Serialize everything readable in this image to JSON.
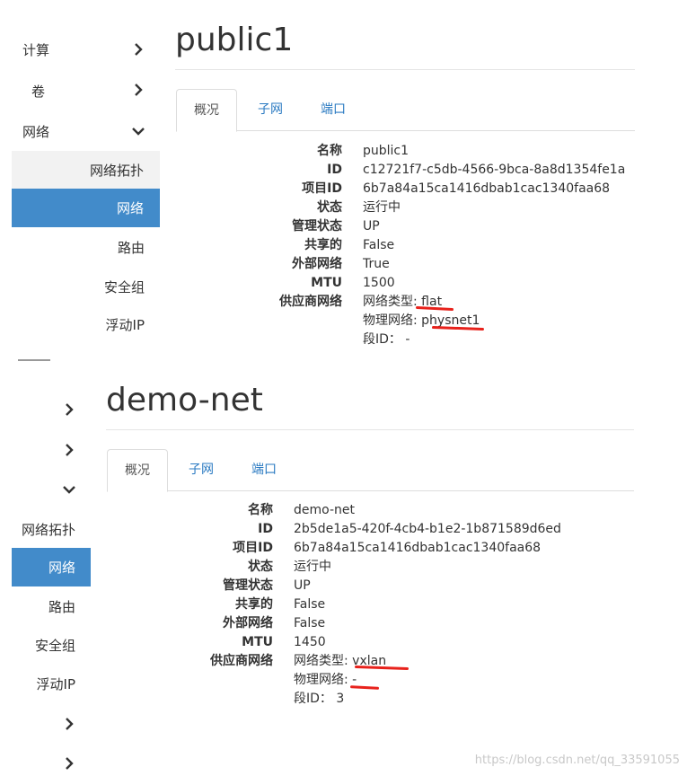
{
  "panel1": {
    "sidebar": {
      "compute": "计算",
      "volumes": "卷",
      "network": "网络",
      "topology": "网络拓扑",
      "networks": "网络",
      "routers": "路由",
      "security_groups": "安全组",
      "floating_ips": "浮动IP"
    },
    "title": "public1",
    "tabs": [
      "概况",
      "子网",
      "端口"
    ],
    "details": [
      {
        "label": "名称",
        "value": "public1"
      },
      {
        "label": "ID",
        "value": "c12721f7-c5db-4566-9bca-8a8d1354fe1a"
      },
      {
        "label": "项目ID",
        "value": "6b7a84a15ca1416dbab1cac1340faa68"
      },
      {
        "label": "状态",
        "value": "运行中"
      },
      {
        "label": "管理状态",
        "value": "UP"
      },
      {
        "label": "共享的",
        "value": "False"
      },
      {
        "label": "外部网络",
        "value": "True"
      },
      {
        "label": "MTU",
        "value": "1500"
      },
      {
        "label": "供应商网络",
        "value": "网络类型: flat"
      }
    ],
    "provider_extra": [
      "物理网络: physnet1",
      "段ID： -"
    ]
  },
  "panel2": {
    "sidebar": {
      "topology": "网络拓扑",
      "networks": "网络",
      "routers": "路由",
      "security_groups": "安全组",
      "floating_ips": "浮动IP"
    },
    "title": "demo-net",
    "tabs": [
      "概况",
      "子网",
      "端口"
    ],
    "details": [
      {
        "label": "名称",
        "value": "demo-net"
      },
      {
        "label": "ID",
        "value": "2b5de1a5-420f-4cb4-b1e2-1b871589d6ed"
      },
      {
        "label": "项目ID",
        "value": "6b7a84a15ca1416dbab1cac1340faa68"
      },
      {
        "label": "状态",
        "value": "运行中"
      },
      {
        "label": "管理状态",
        "value": "UP"
      },
      {
        "label": "共享的",
        "value": "False"
      },
      {
        "label": "外部网络",
        "value": "False"
      },
      {
        "label": "MTU",
        "value": "1450"
      },
      {
        "label": "供应商网络",
        "value": "网络类型: vxlan"
      }
    ],
    "provider_extra": [
      "物理网络: -",
      "段ID： 3"
    ]
  },
  "watermark": "https://blog.csdn.net/qq_33591055",
  "colors": {
    "active": "#428bca",
    "link": "#2a7ac2",
    "annotation": "#e8221c"
  }
}
